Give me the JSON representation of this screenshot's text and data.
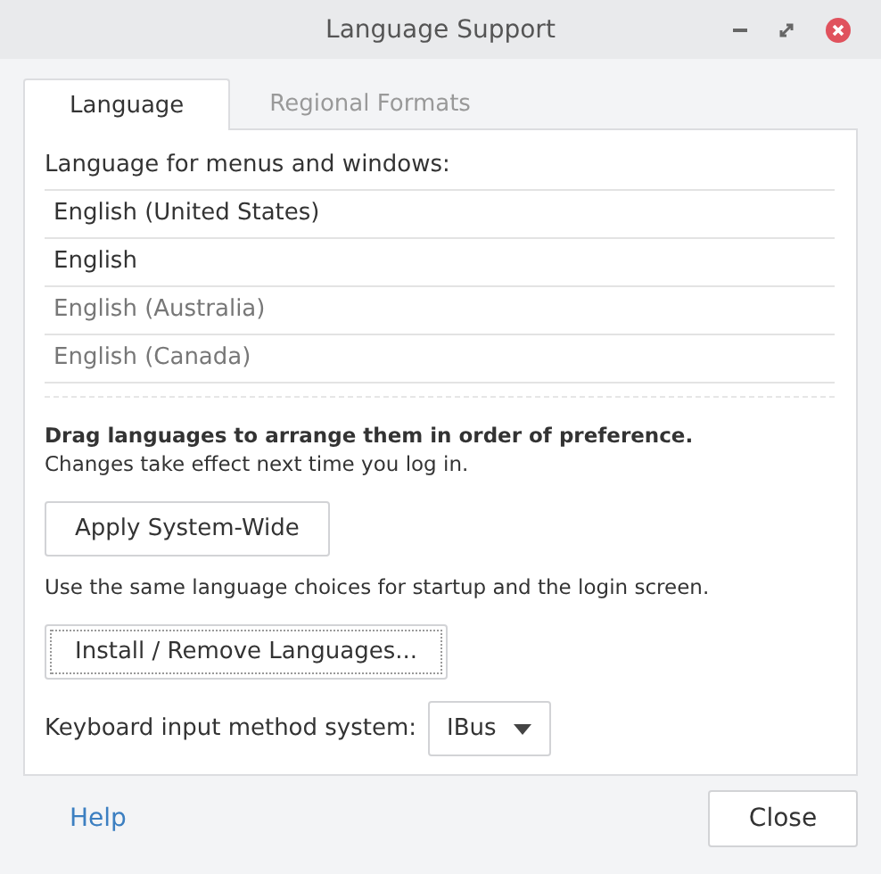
{
  "window": {
    "title": "Language Support"
  },
  "tabs": [
    {
      "label": "Language",
      "selected": true
    },
    {
      "label": "Regional Formats",
      "selected": false
    }
  ],
  "language_list": {
    "heading": "Language for menus and windows:",
    "items": [
      {
        "label": "English (United States)",
        "disabled": false
      },
      {
        "label": "English",
        "disabled": false
      },
      {
        "label": "English (Australia)",
        "disabled": true
      },
      {
        "label": "English (Canada)",
        "disabled": true
      }
    ]
  },
  "hint_bold": "Drag languages to arrange them in order of preference.",
  "hint": "Changes take effect next time you log in.",
  "apply_button": {
    "label": "Apply System-Wide",
    "focused": false
  },
  "apply_note": "Use the same language choices for startup and the login screen.",
  "install_button": {
    "label": "Install / Remove Languages...",
    "focused": true
  },
  "input_method": {
    "label": "Keyboard input method system:",
    "value": "IBus"
  },
  "help_link": "Help",
  "close_button": "Close"
}
